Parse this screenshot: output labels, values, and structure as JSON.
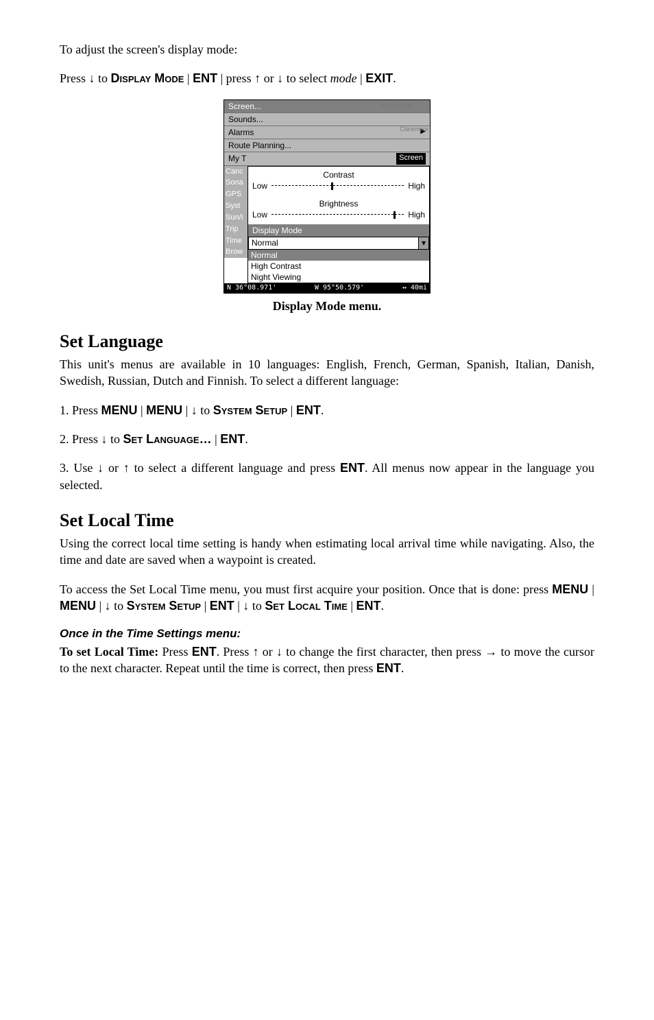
{
  "intro": "To adjust the screen's display mode:",
  "instr1": {
    "press": "Press ",
    "arrow_down": "↓",
    "to": " to ",
    "display_mode": "Display Mode",
    "pipe": " | ",
    "ent": "ENT",
    "press2": " | press ",
    "arrow_up": "↑",
    "or": " or ",
    "to2": " to select ",
    "mode_italic": "mode",
    "exit": "EXIT",
    "period": "."
  },
  "figure": {
    "menu": {
      "items": [
        "Screen...",
        "Sounds...",
        "Alarms",
        "Route Planning...",
        "My T"
      ],
      "maptext1": "ologan Lake",
      "maptext2": "Claremore",
      "screen_tag": "Screen"
    },
    "sidebar": [
      "Canc",
      "Sona",
      "GPS",
      "Syst",
      "Sun/I",
      "Trip",
      "Time",
      "Brow"
    ],
    "screen_panel": {
      "contrast": "Contrast",
      "brightness": "Brightness",
      "low": "Low",
      "high": "High",
      "display_mode": "Display Mode",
      "selected": "Normal",
      "options": [
        "Normal",
        "High Contrast",
        "Night Viewing"
      ]
    },
    "status": {
      "lat": "N   36°08.971'",
      "lon": "W   95°50.579'",
      "scale": "↔   40mi"
    },
    "caption": "Display Mode menu."
  },
  "sec_lang": {
    "title": "Set Language",
    "p1": "This unit's menus are available in 10 languages: English, French, German, Spanish, Italian, Danish, Swedish, Russian, Dutch and Finnish. To select a different language:",
    "step1": {
      "pre": "1. Press ",
      "menu": "MENU",
      "pipe": " | ",
      "arrow_down": "↓",
      "to": " to ",
      "system_setup": "System Setup",
      "ent": "ENT",
      "period": "."
    },
    "step2": {
      "pre": "2. Press ",
      "arrow_down": "↓",
      "to": " to ",
      "set_language": "Set Language…",
      "pipe": " | ",
      "ent": "ENT",
      "period": "."
    },
    "step3": {
      "pre": "3. Use ",
      "arrow_down": "↓",
      "or": " or ",
      "arrow_up": "↑",
      "mid": " to select a different language and press ",
      "ent": "ENT",
      "tail": ". All menus now appear in the language you selected."
    }
  },
  "sec_time": {
    "title": "Set Local Time",
    "p1": "Using the correct local time setting is handy when estimating local arrival time while navigating. Also, the time and date are saved when a waypoint is created.",
    "p2": {
      "pre": "To access the Set Local Time menu, you must first acquire your position. Once that is done: press ",
      "menu": "MENU",
      "pipe": " | ",
      "arrow_down": "↓",
      "to": " to ",
      "system_setup": "System Setup",
      "ent": "ENT",
      "set_local_time": "Set Local Time",
      "period": "."
    },
    "subhead": "Once in the Time Settings menu:",
    "p3": {
      "bold_lead": "To set Local Time:",
      "press": " Press ",
      "ent": "ENT",
      "press2": ". Press ",
      "arrow_up": "↑",
      "or": " or ",
      "arrow_down": "↓",
      "mid": " to change the first character, then press ",
      "arrow_right": "→",
      "tail": " to move the cursor to the next character. Repeat until the time is correct, then press ",
      "period": "."
    }
  }
}
